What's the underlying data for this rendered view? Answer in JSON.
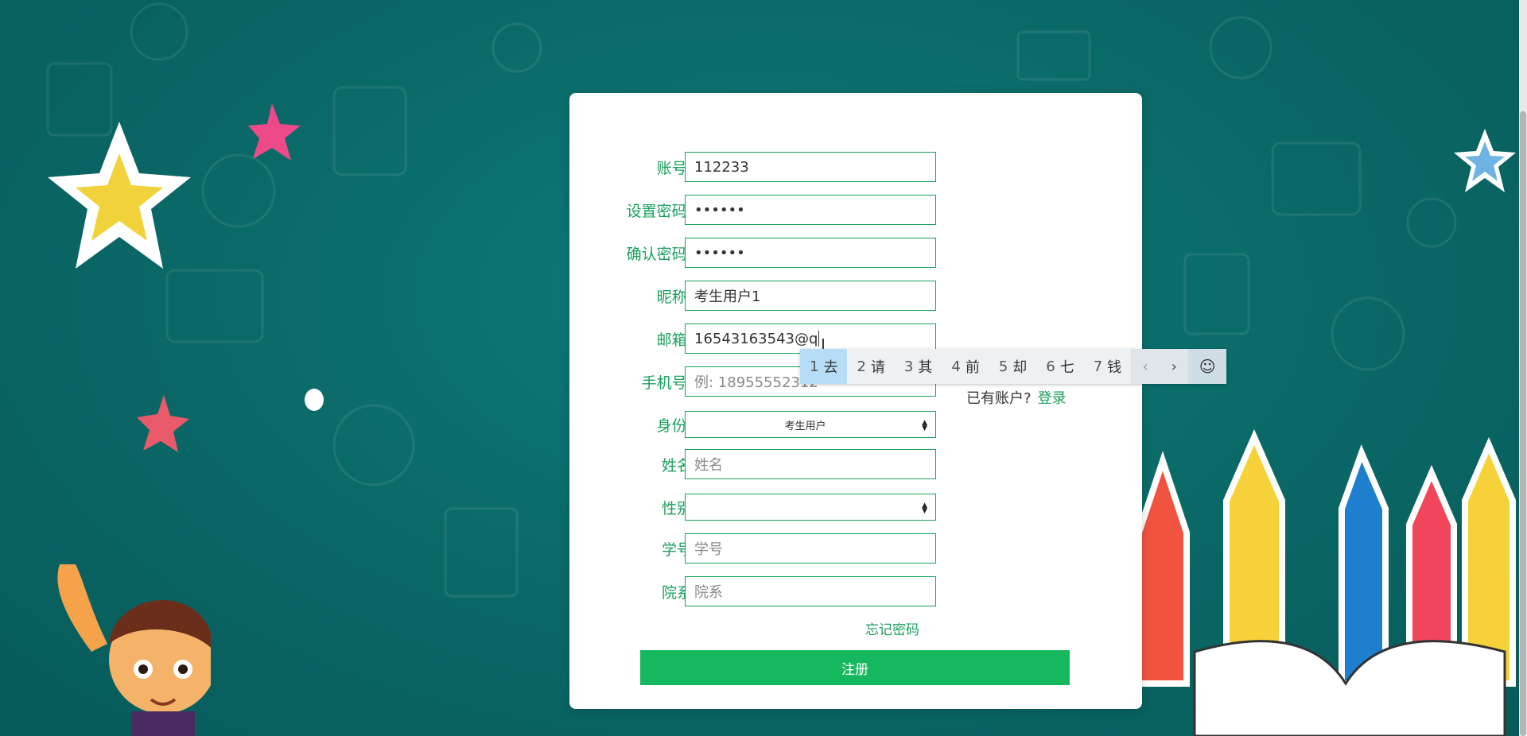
{
  "form": {
    "fields": [
      {
        "label": "账号:",
        "value": "112233",
        "placeholder": ""
      },
      {
        "label": "设置密码:",
        "value": "••••••",
        "placeholder": ""
      },
      {
        "label": "确认密码:",
        "value": "••••••",
        "placeholder": ""
      },
      {
        "label": "昵称:",
        "value": "考生用户1",
        "placeholder": ""
      },
      {
        "label": "邮箱:",
        "value": "16543163543@q",
        "placeholder": ""
      },
      {
        "label": "手机号:",
        "value": "",
        "placeholder": "例: 18955552312"
      },
      {
        "label": "身份:",
        "value": "考生用户",
        "placeholder": ""
      },
      {
        "label": "姓名",
        "value": "",
        "placeholder": "姓名"
      },
      {
        "label": "性别",
        "value": "",
        "placeholder": ""
      },
      {
        "label": "学号",
        "value": "",
        "placeholder": "学号"
      },
      {
        "label": "院系",
        "value": "",
        "placeholder": "院系"
      }
    ],
    "forgot_label": "忘记密码",
    "submit_label": "注册",
    "have_account_text": "已有账户?",
    "login_link": "登录"
  },
  "ime": {
    "candidates": [
      {
        "num": "1",
        "text": "去"
      },
      {
        "num": "2",
        "text": "请"
      },
      {
        "num": "3",
        "text": "其"
      },
      {
        "num": "4",
        "text": "前"
      },
      {
        "num": "5",
        "text": "却"
      },
      {
        "num": "6",
        "text": "七"
      },
      {
        "num": "7",
        "text": "钱"
      }
    ],
    "prev_icon": "‹",
    "next_icon": "›",
    "emoji_icon": "☺"
  },
  "colors": {
    "accent": "#1aa05c",
    "button": "#16b85d",
    "background": "#0a6866"
  }
}
